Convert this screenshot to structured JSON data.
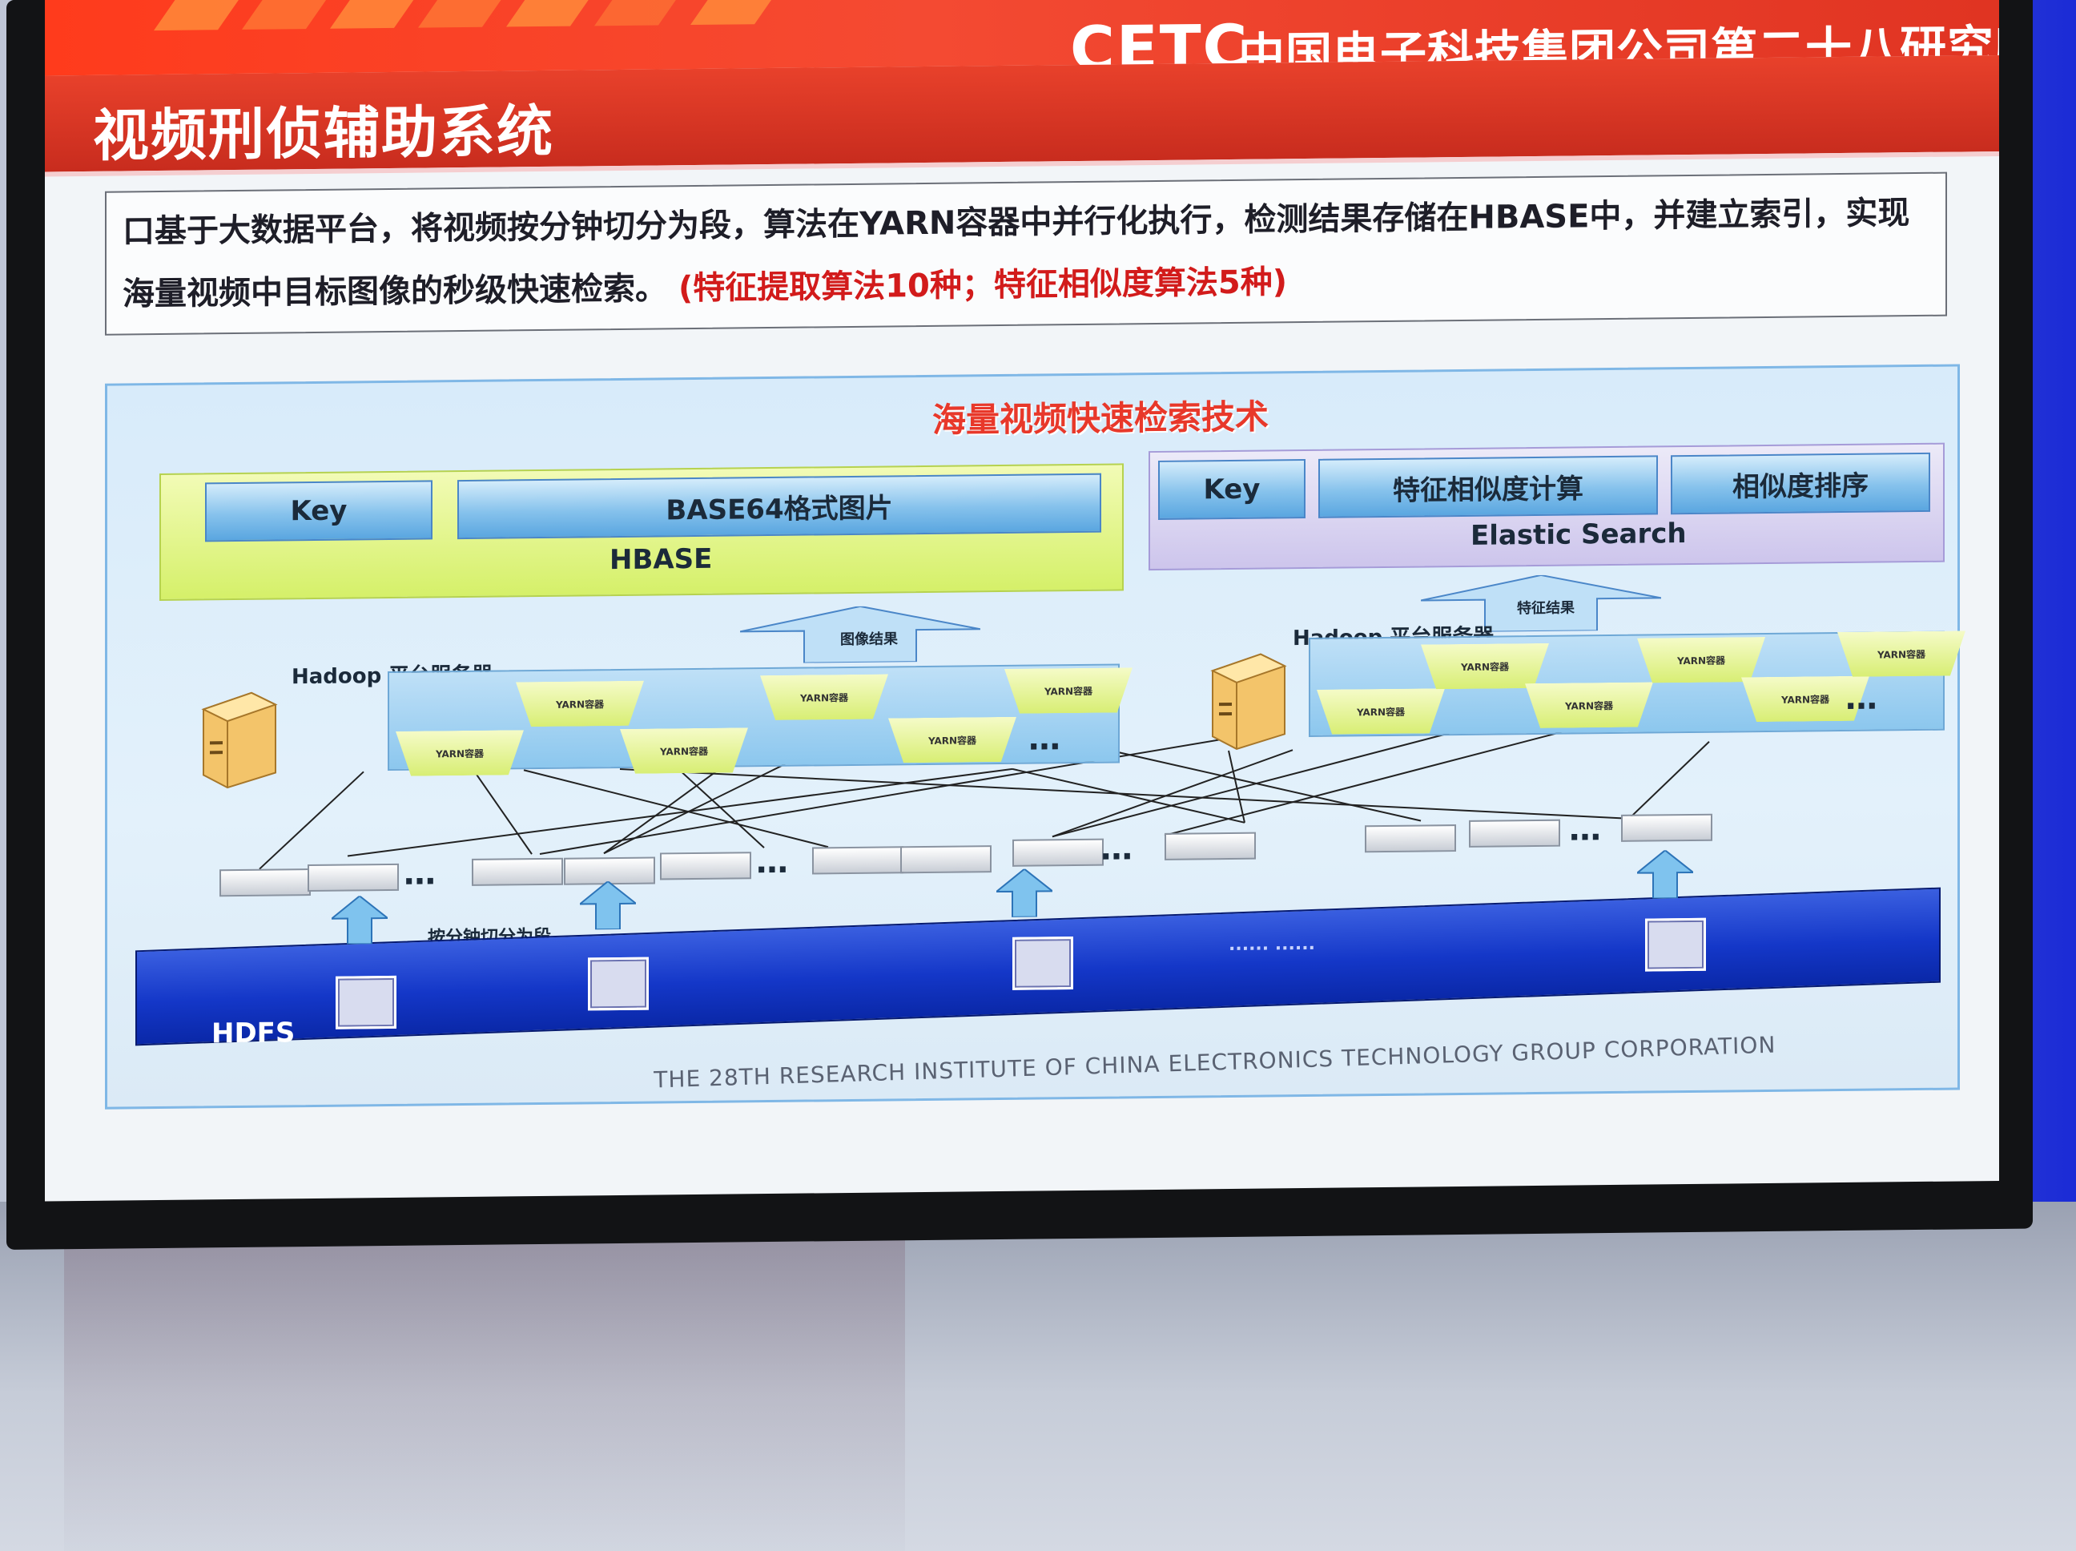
{
  "header": {
    "logo": "CETC",
    "organization": "中国电子科技集团公司第二十八研究所",
    "title": "视频刑侦辅助系统"
  },
  "description": {
    "text": "口基于大数据平台，将视频按分钟切分为段，算法在YARN容器中并行化执行，检测结果存储在HBASE中，并建立索引，实现海量视频中目标图像的秒级快速检索。",
    "highlight": "(特征提取算法10种；特征相似度算法5种)"
  },
  "diagram": {
    "title": "海量视频快速检索技术",
    "hbase": {
      "key_label": "Key",
      "image_label": "BASE64格式图片",
      "panel_label": "HBASE"
    },
    "elastic": {
      "key_label": "Key",
      "similarity_calc_label": "特征相似度计算",
      "sort_label": "相似度排序",
      "panel_label": "Elastic Search"
    },
    "arrow_left_label": "图像结果",
    "arrow_right_label": "特征结果",
    "hadoop_left_label": "Hadoop 平台服务器",
    "hadoop_right_label": "Hadoop 平台服务器",
    "segment_label": "按分钟切分为段",
    "hdfs_label": "HDFS",
    "ellipsis": "…",
    "hdfs_ellipsis": "...... ......",
    "container_label": "YARN容器",
    "colors": {
      "topbar": "#f44a32",
      "diagram_title": "#e8382a",
      "hdfs": "#1437c8",
      "hbase_panel": "#d5f069",
      "es_panel": "#cdc5ec"
    }
  },
  "footer": {
    "text": "THE 28TH RESEARCH INSTITUTE OF CHINA ELECTRONICS TECHNOLOGY GROUP CORPORATION"
  }
}
